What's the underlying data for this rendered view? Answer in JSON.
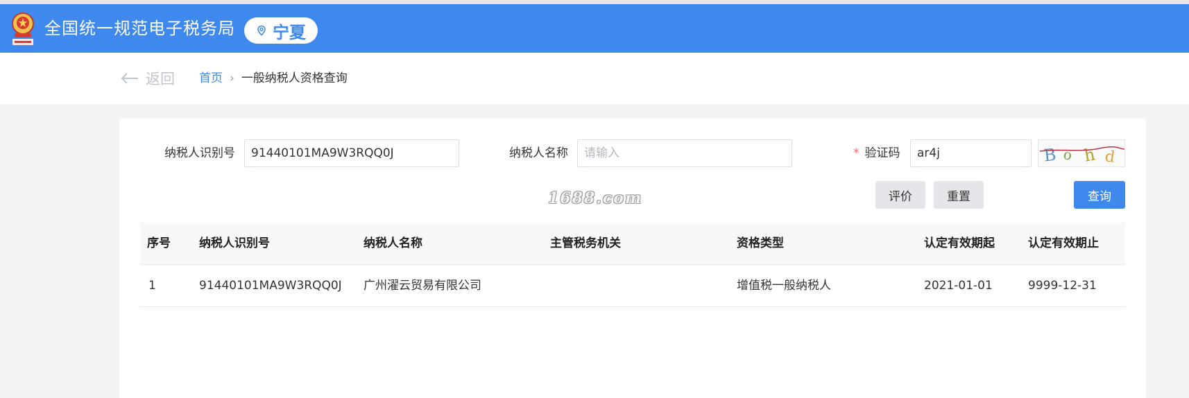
{
  "header": {
    "title": "全国统一规范电子税务局",
    "region": "宁夏",
    "icons": {
      "emblem": "national-emblem-icon",
      "region": "location-pin-icon"
    },
    "colors": {
      "brand": "#3f89ee"
    }
  },
  "nav": {
    "back_label": "返回",
    "breadcrumb": {
      "home": "首页",
      "separator": "›",
      "current": "一般纳税人资格查询"
    }
  },
  "form": {
    "taxpayer_id_label": "纳税人识别号",
    "taxpayer_id_value": "91440101MA9W3RQQ0J",
    "taxpayer_name_label": "纳税人名称",
    "taxpayer_name_placeholder": "请输入",
    "captcha_required_mark": "*",
    "captcha_label": "验证码",
    "captcha_value": "ar4j",
    "captcha_image_text": "Bohd"
  },
  "buttons": {
    "evaluate": "评价",
    "reset": "重置",
    "query": "查询"
  },
  "watermark": "1688.com",
  "table": {
    "columns": [
      "序号",
      "纳税人识别号",
      "纳税人名称",
      "主管税务机关",
      "资格类型",
      "认定有效期起",
      "认定有效期止"
    ],
    "rows": [
      {
        "index": "1",
        "taxpayer_id": "91440101MA9W3RQQ0J",
        "taxpayer_name": "广州濯云贸易有限公司",
        "tax_authority": "",
        "qualification_type": "增值税一般纳税人",
        "valid_from": "2021-01-01",
        "valid_to": "9999-12-31"
      }
    ]
  }
}
